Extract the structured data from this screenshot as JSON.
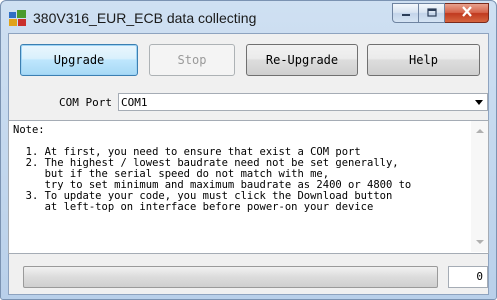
{
  "window": {
    "title": "380V316_EUR_ECB data collecting"
  },
  "toolbar": {
    "upgrade_label": "Upgrade",
    "stop_label": "Stop",
    "reupgrade_label": "Re-Upgrade",
    "help_label": "Help"
  },
  "com_port": {
    "label": "COM Port",
    "value": "COM1"
  },
  "notes": {
    "text": "Note:\n\n  1. At first, you need to ensure that exist a COM port\n  2. The highest / lowest baudrate need not be set generally,\n     but if the serial speed do not match with me,\n     try to set minimum and maximum baudrate as 2400 or 4800 to\n  3. To update your code, you must click the Download button\n     at left-top on interface before power-on your device"
  },
  "status": {
    "progress_fraction": 0,
    "count": "0"
  },
  "icons": {
    "app": "app-icon",
    "minimize": "minimize-icon",
    "maximize": "maximize-icon",
    "close": "close-icon"
  },
  "colors": {
    "title_bar": "#b9d0ea",
    "close_button": "#c0391f",
    "focused_button": "#bee6fd"
  }
}
